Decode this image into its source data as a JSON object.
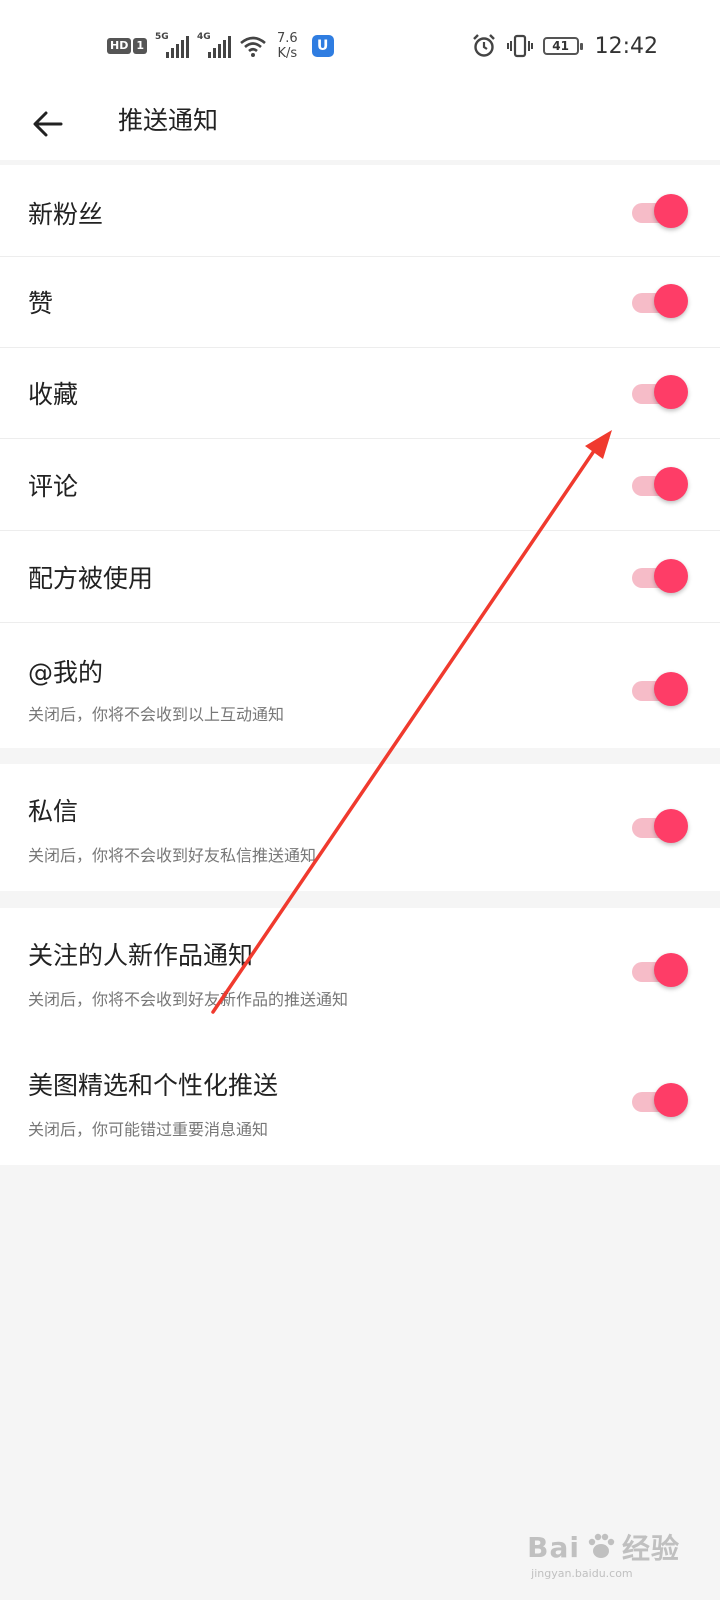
{
  "status_bar": {
    "hd_label": "HD",
    "sim_label": "1",
    "sig1_tag": "5G",
    "sig2_tag": "4G",
    "speed_value": "7.6",
    "speed_unit": "K/s",
    "app_icon_letter": "U",
    "battery_level": "41",
    "time": "12:42"
  },
  "header": {
    "title": "推送通知"
  },
  "groups": [
    {
      "items": [
        {
          "title": "新粉丝",
          "subtitle": "",
          "enabled": true
        },
        {
          "title": "赞",
          "subtitle": "",
          "enabled": true
        },
        {
          "title": "收藏",
          "subtitle": "",
          "enabled": true
        },
        {
          "title": "评论",
          "subtitle": "",
          "enabled": true
        },
        {
          "title": "配方被使用",
          "subtitle": "",
          "enabled": true
        },
        {
          "title": "@我的",
          "subtitle": "关闭后，你将不会收到以上互动通知",
          "enabled": true
        }
      ]
    },
    {
      "items": [
        {
          "title": "私信",
          "subtitle": "关闭后，你将不会收到好友私信推送通知",
          "enabled": true
        }
      ]
    },
    {
      "items": [
        {
          "title": "关注的人新作品通知",
          "subtitle": "关闭后，你将不会收到好友新作品的推送通知",
          "enabled": true
        },
        {
          "title": "美图精选和个性化推送",
          "subtitle": "关闭后，你可能错过重要消息通知",
          "enabled": true
        }
      ]
    }
  ],
  "colors": {
    "toggle_on_knob": "#fe3d67",
    "toggle_on_track": "#f6bcc8",
    "annotation_arrow": "#f03a2e"
  },
  "watermark": {
    "main_text": "Bai",
    "main_text_2": "经验",
    "sub_text": "jingyan.baidu.com"
  }
}
